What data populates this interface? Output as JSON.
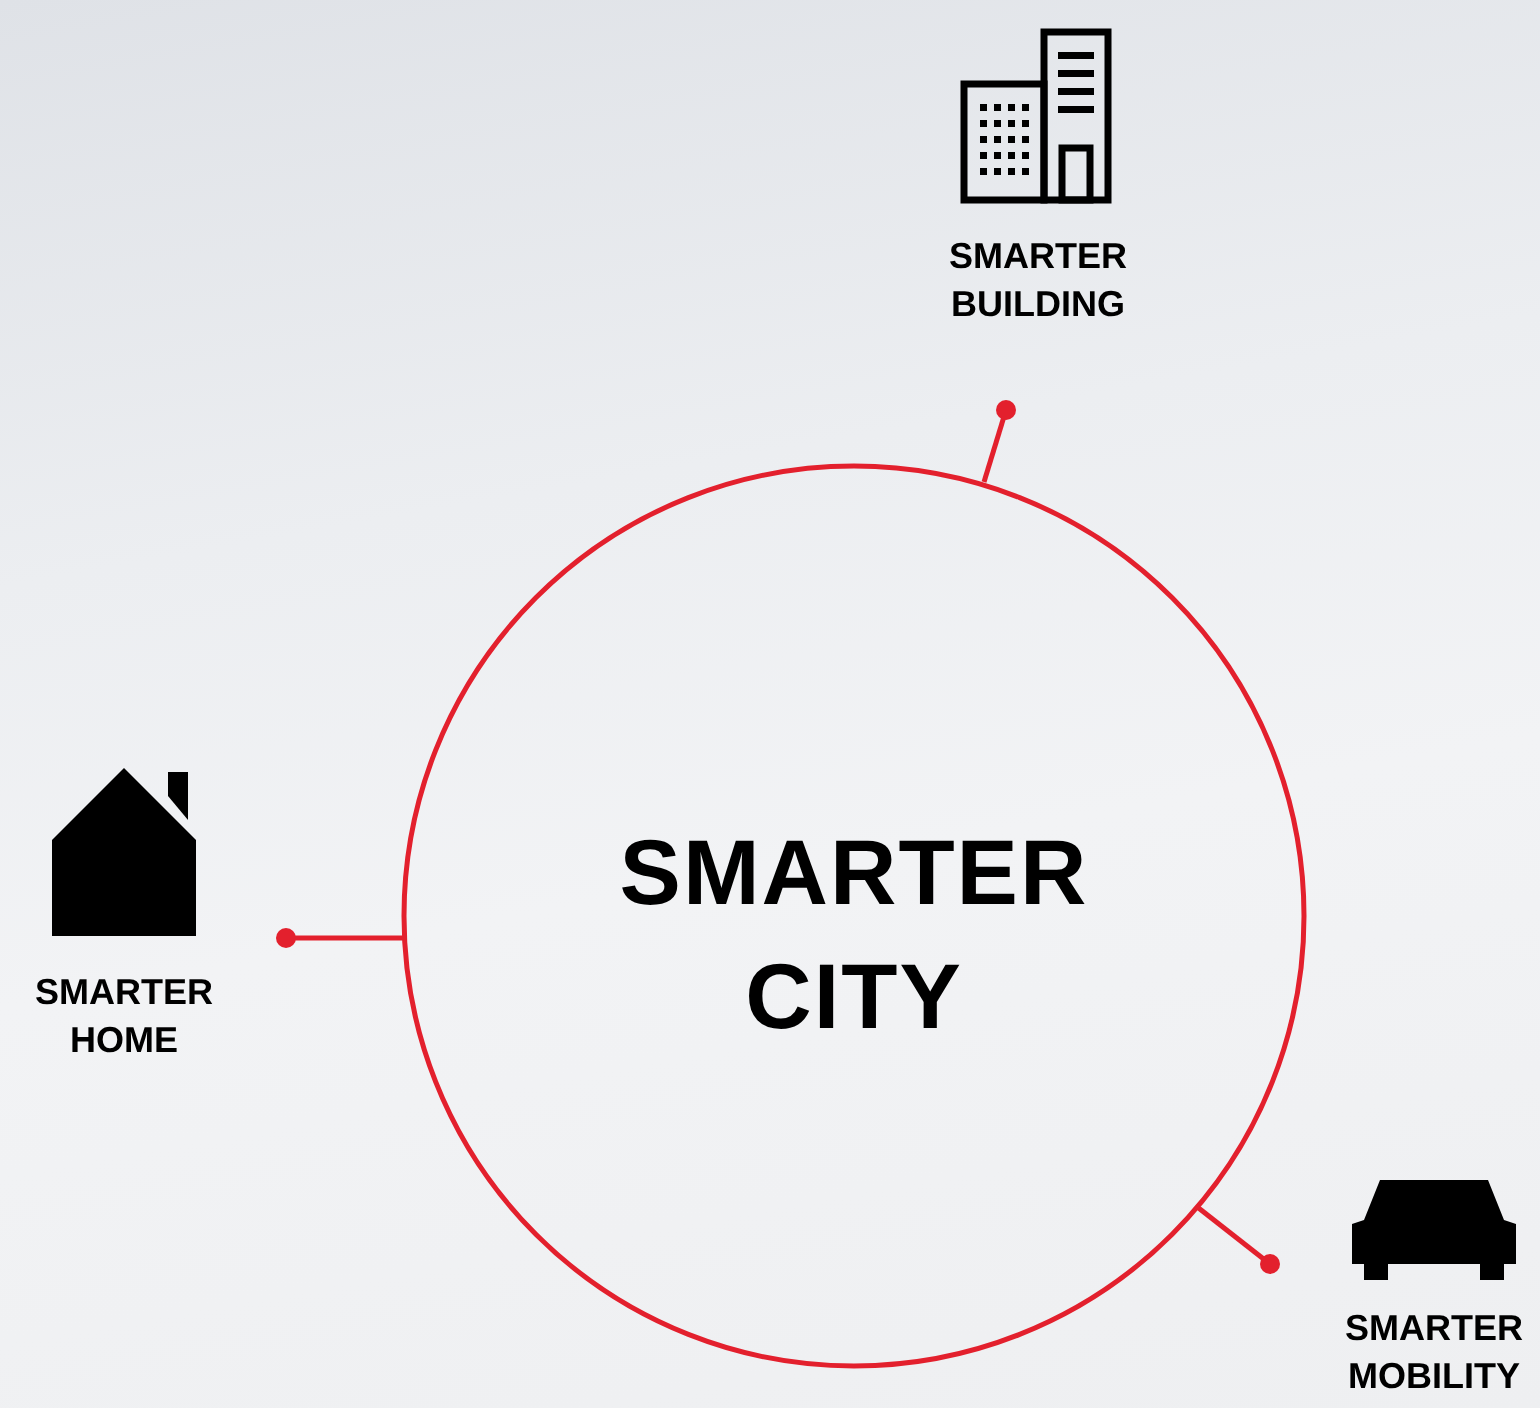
{
  "center_label": "SMARTER CITY",
  "nodes": [
    {
      "kind": "building",
      "label": "SMARTER BUILDING"
    },
    {
      "kind": "home",
      "label": "SMARTER HOME"
    },
    {
      "kind": "car",
      "label": "SMARTER MOBILITY"
    }
  ]
}
